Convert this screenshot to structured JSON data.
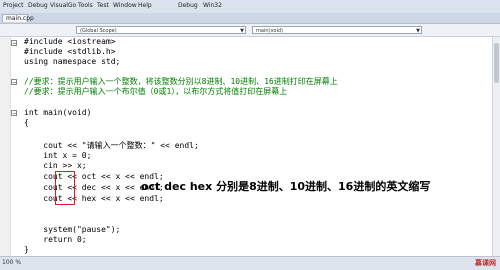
{
  "menu": {
    "items": [
      "Project",
      "Debug",
      "VisualGo",
      "Tools",
      "Test",
      "Window",
      "Help",
      "Debug",
      "Win32"
    ],
    "more": "▾"
  },
  "tab": {
    "label": "main.cpp"
  },
  "dropdowns": {
    "scope": "(Global Scope)",
    "member": "main(void)"
  },
  "code": {
    "lines": [
      "#include <iostream>",
      "#include <stdlib.h>",
      "using namespace std;",
      "",
      "//要求：提示用户输入一个整数，将该整数分别以8进制、10进制、16进制打印在屏幕上",
      "//要求：提示用户输入一个布尔值（0或1），以布尔方式将值打印在屏幕上",
      "",
      "int main(void)",
      "{",
      "",
      "    cout << \"请输入一个整数：\" << endl;",
      "    int x = 0;",
      "    cin >> x;",
      "    cout << oct << x << endl;",
      "    cout << dec << x << endl;",
      "    cout << hex << x << endl;",
      "",
      "",
      "    system(\"pause\");",
      "    return 0;",
      "}"
    ]
  },
  "annotation": "oct dec hex 分别是8进制、10进制、16进制的英文缩写",
  "status": {
    "zoom": "100 %",
    "logo": "慕课网"
  }
}
